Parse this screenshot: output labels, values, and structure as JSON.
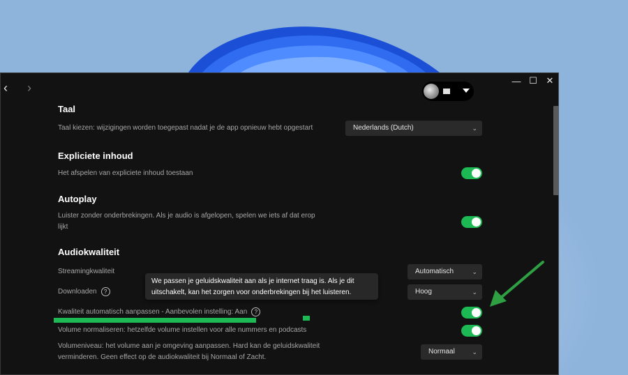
{
  "window": {
    "nav_back": "‹",
    "nav_forward": "›",
    "controls": {
      "minimize": "—",
      "maximize": "☐",
      "close": "✕"
    }
  },
  "profile": {
    "name_masked": "",
    "avatar_icon": "user-avatar"
  },
  "sections": {
    "taal": {
      "heading": "Taal",
      "label": "Taal kiezen: wijzigingen worden toegepast nadat je de app opnieuw hebt opgestart",
      "select_value": "Nederlands (Dutch)"
    },
    "expliciet": {
      "heading": "Expliciete inhoud",
      "label": "Het afspelen van expliciete inhoud toestaan",
      "toggle_on": true
    },
    "autoplay": {
      "heading": "Autoplay",
      "label_line1": "Luister zonder onderbrekingen. Als je audio is afgelopen, spelen we iets af dat erop",
      "label_line2": "lijkt",
      "toggle_on": true
    },
    "audio": {
      "heading": "Audiokwaliteit",
      "streaming_label": "Streamingkwaliteit",
      "streaming_value": "Automatisch",
      "download_label": "Downloaden",
      "download_value": "Hoog",
      "auto_adjust_label": "Kwaliteit automatisch aanpassen - Aanbevolen instelling: Aan",
      "auto_adjust_on": true,
      "normalize_label": "Volume normaliseren: hetzelfde volume instellen voor alle nummers en podcasts",
      "normalize_on": true,
      "volume_level_line1": "Volumeniveau: het volume aan je omgeving aanpassen. Hard kan de geluidskwaliteit",
      "volume_level_line2": "verminderen. Geen effect op de audiokwaliteit bij Normaal of Zacht.",
      "volume_level_value": "Normaal"
    }
  },
  "tooltip": {
    "line1": "We passen je geluidskwaliteit aan als je internet traag is. Als je dit",
    "line2": "uitschakelt, kan het zorgen voor onderbrekingen bij het luisteren."
  },
  "help_glyph": "?",
  "chevron_glyph": "⌄",
  "colors": {
    "accent_green": "#1db954",
    "background": "#121212",
    "annotation_green": "#2ea043"
  }
}
